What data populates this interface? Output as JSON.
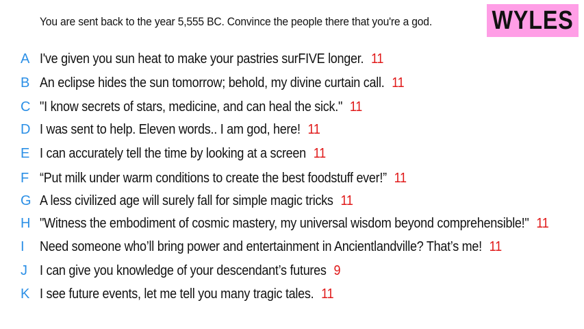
{
  "prompt": "You are sent back to the year 5,555 BC. Convince the people there that you're a god.",
  "badge": "WYLES",
  "colors": {
    "letter": "#2b8fe6",
    "count": "#e01818",
    "badge_bg": "#ff9ee6"
  },
  "answers": [
    {
      "letter": "A",
      "text": "I've given you sun heat to make your pastries surFIVE longer.",
      "count": "11"
    },
    {
      "letter": "B",
      "text": "An eclipse hides the sun tomorrow; behold, my divine curtain call.",
      "count": "11"
    },
    {
      "letter": "C",
      "text": "\"I know secrets of stars, medicine, and can heal the sick.\"",
      "count": "11"
    },
    {
      "letter": "D",
      "text": "I was sent to help. Eleven words.. I am god, here!",
      "count": "11"
    },
    {
      "letter": "E",
      "text": "I can accurately tell the time by looking at a screen",
      "count": "11"
    },
    {
      "letter": "F",
      "text": "“Put milk under warm conditions to create the best foodstuff ever!”",
      "count": "11"
    },
    {
      "letter": "G",
      "text": "A less civilized age will surely fall for simple magic tricks",
      "count": "11"
    },
    {
      "letter": "H",
      "text": "\"Witness the embodiment of cosmic mastery, my universal wisdom beyond comprehensible!\"",
      "count": "11"
    },
    {
      "letter": "I",
      "text": "Need someone who’ll bring power and entertainment in Ancientlandville? That’s me!",
      "count": "11"
    },
    {
      "letter": "J",
      "text": "I can give you knowledge of your descendant’s futures",
      "count": "9"
    },
    {
      "letter": "K",
      "text": "I see future events, let me tell you many tragic tales.",
      "count": "11"
    }
  ]
}
